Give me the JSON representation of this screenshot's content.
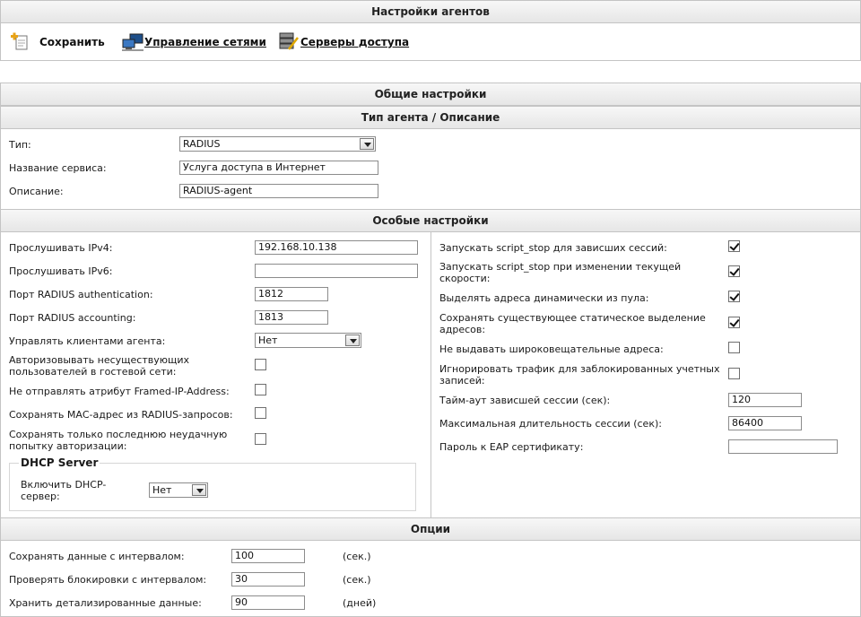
{
  "agent_settings": {
    "title": "Настройки агентов",
    "toolbar": {
      "save_label": "Сохранить",
      "networks_label": "Управление сетями",
      "servers_label": "Серверы доступа"
    }
  },
  "general": {
    "title": "Общие настройки",
    "type_section_title": "Тип агента / Описание",
    "type_label": "Тип:",
    "type_value": "RADIUS",
    "service_label": "Название сервиса:",
    "service_value": "Услуга доступа в Интернет",
    "description_label": "Описание:",
    "description_value": "RADIUS-agent"
  },
  "special": {
    "title": "Особые настройки",
    "left": {
      "ipv4_label": "Прослушивать IPv4:",
      "ipv4_value": "192.168.10.138",
      "ipv6_label": "Прослушивать IPv6:",
      "ipv6_value": "",
      "auth_port_label": "Порт RADIUS authentication:",
      "auth_port_value": "1812",
      "acct_port_label": "Порт RADIUS accounting:",
      "acct_port_value": "1813",
      "manage_clients_label": "Управлять клиентами агента:",
      "manage_clients_value": "Нет",
      "guest_auth_label_1": "Авторизовывать несуществующих",
      "guest_auth_label_2": "пользователей в гостевой сети:",
      "guest_auth_checked": false,
      "framed_ip_label": "Не отправлять атрибут Framed-IP-Address:",
      "framed_ip_checked": false,
      "save_mac_label": "Сохранять МАС-адрес из RADIUS-запросов:",
      "save_mac_checked": false,
      "last_fail_label_1": "Сохранять только последнюю неудачную",
      "last_fail_label_2": "попытку авторизации:",
      "last_fail_checked": false,
      "dhcp": {
        "legend": "DHCP Server",
        "enable_label_1": "Включить DHCP-",
        "enable_label_2": "сервер:",
        "enable_value": "Нет"
      }
    },
    "right": {
      "script_stop_hung_label": "Запускать script_stop для зависших сессий:",
      "script_stop_hung_checked": true,
      "script_stop_speed_label_1": "Запускать script_stop при изменении текущей",
      "script_stop_speed_label_2": "скорости:",
      "script_stop_speed_checked": true,
      "dynamic_pool_label": "Выделять адреса динамически из пула:",
      "dynamic_pool_checked": true,
      "keep_static_label_1": "Сохранять существующее статическое выделение",
      "keep_static_label_2": "адресов:",
      "keep_static_checked": true,
      "no_broadcast_label": "Не выдавать широковещательные адреса:",
      "no_broadcast_checked": false,
      "ignore_blocked_label_1": "Игнорировать трафик для заблокированных учетных",
      "ignore_blocked_label_2": "записей:",
      "ignore_blocked_checked": false,
      "hung_timeout_label": "Тайм-аут зависшей сессии (сек):",
      "hung_timeout_value": "120",
      "max_session_label": "Максимальная длительность сессии (сек):",
      "max_session_value": "86400",
      "eap_password_label": "Пароль к EAP сертификату:",
      "eap_password_value": ""
    }
  },
  "options": {
    "title": "Опции",
    "save_interval_label": "Сохранять данные с интервалом:",
    "save_interval_value": "100",
    "save_interval_unit": "(сек.)",
    "check_blocks_label": "Проверять блокировки с интервалом:",
    "check_blocks_value": "30",
    "check_blocks_unit": "(сек.)",
    "keep_detailed_label": "Хранить детализированные данные:",
    "keep_detailed_value": "90",
    "keep_detailed_unit": "(дней)"
  },
  "colors": {
    "header_bg": "#ececec",
    "border": "#c4c4c4",
    "text": "#1a1a1a"
  },
  "icons": {
    "save": "save-plus-icon",
    "networks": "network-computers-icon",
    "servers": "server-stack-icon"
  }
}
